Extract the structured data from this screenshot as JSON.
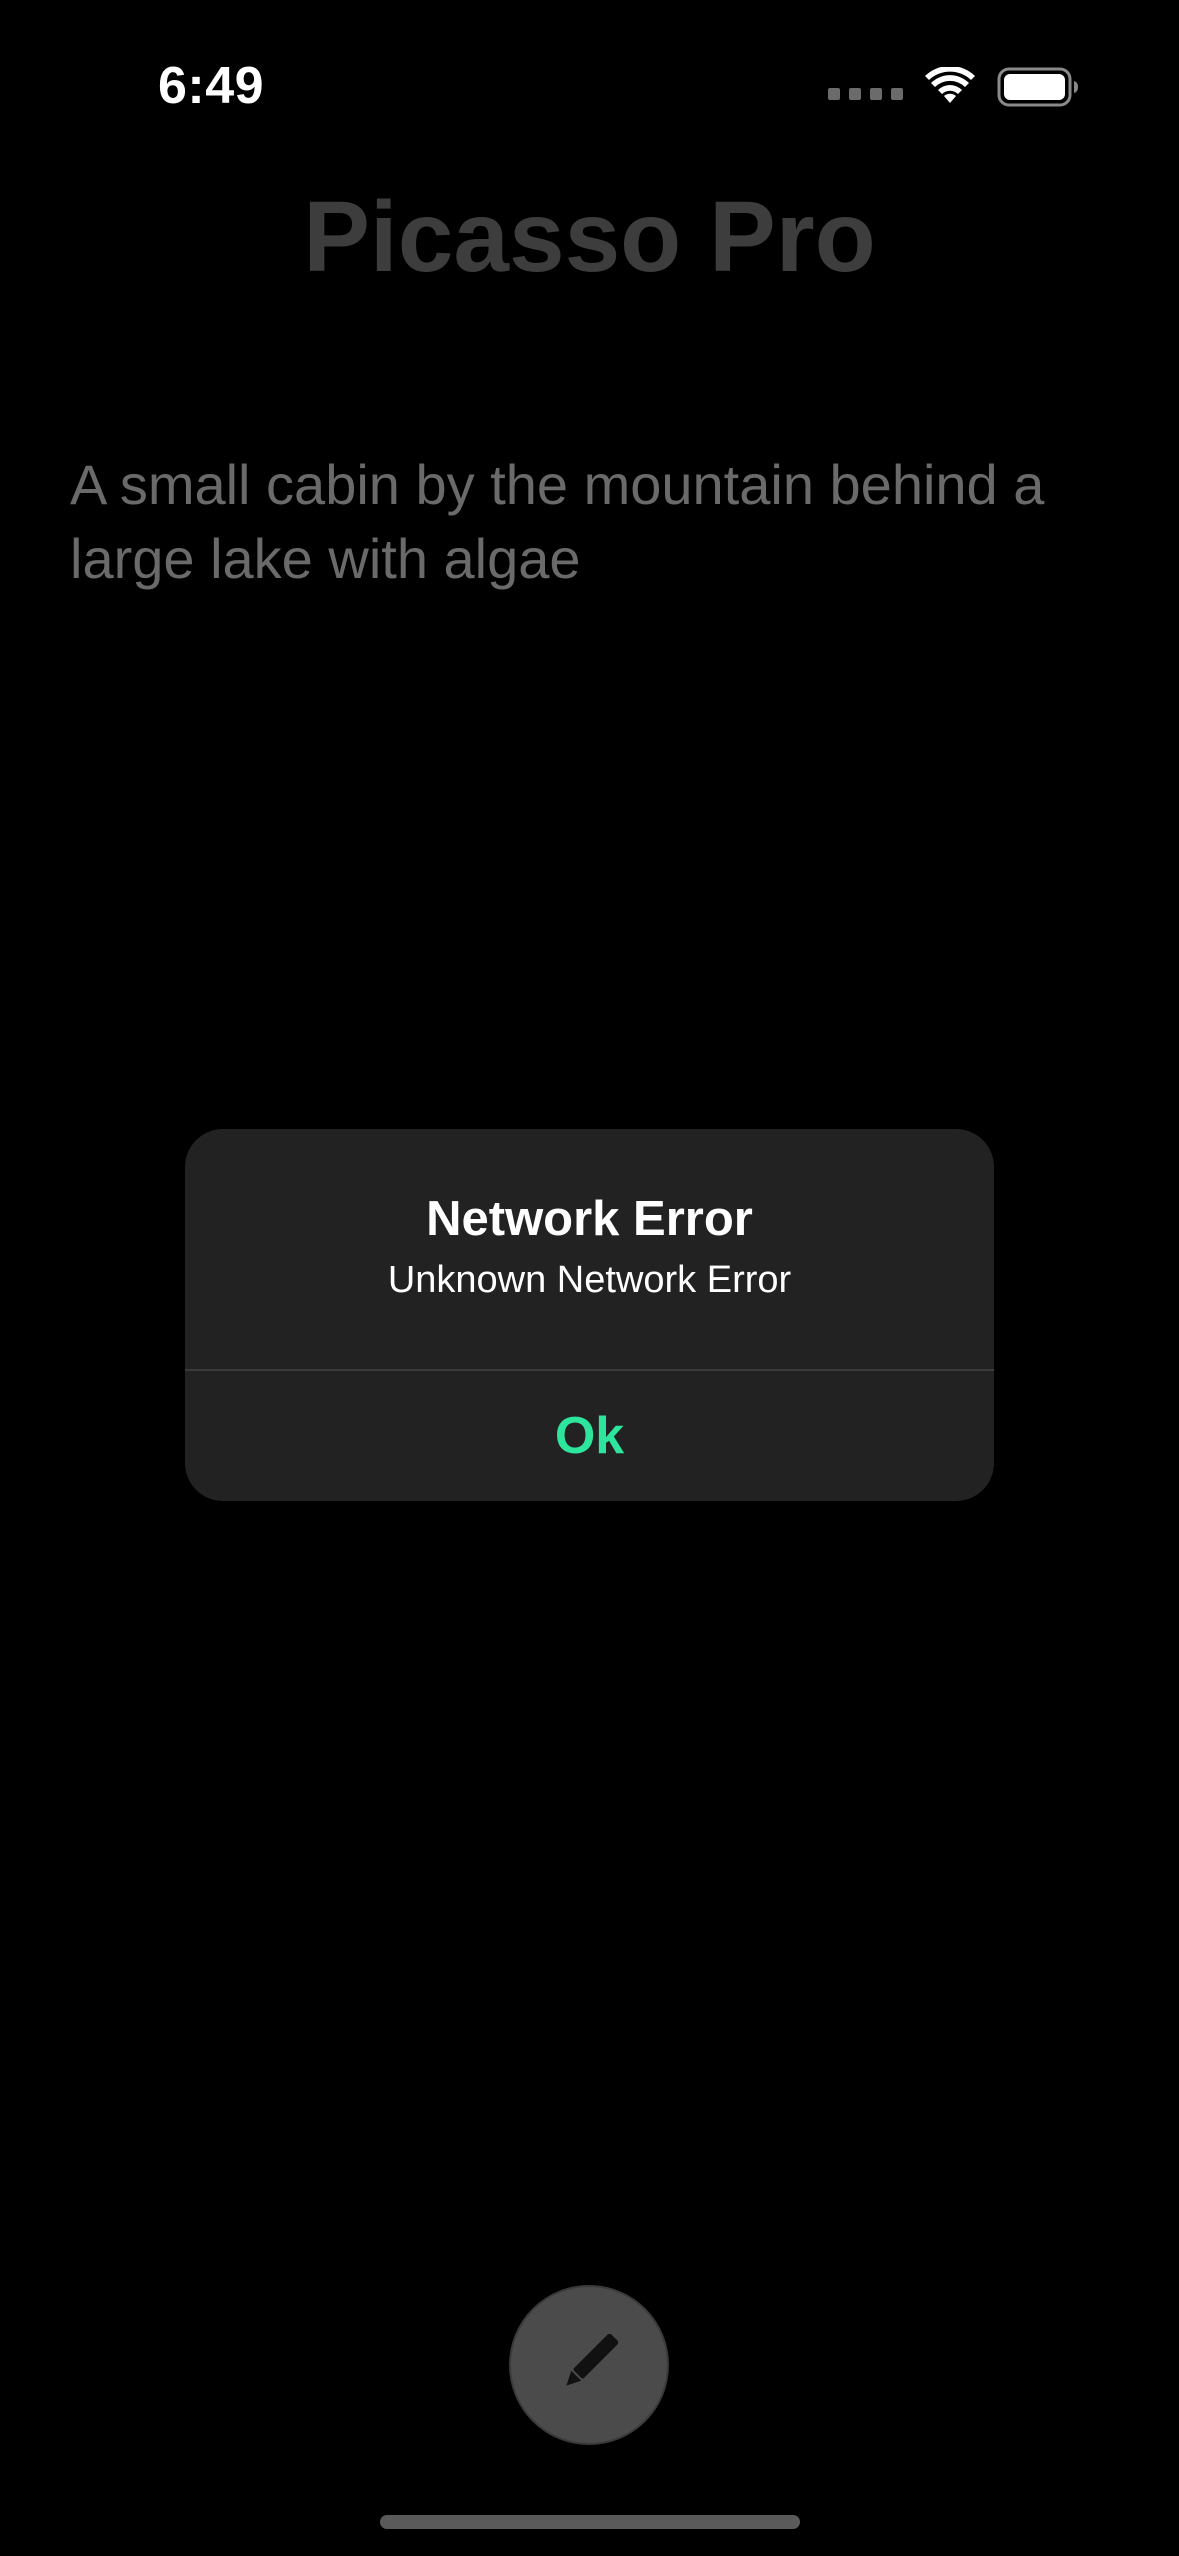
{
  "status_bar": {
    "time": "6:49",
    "icons": [
      "signal-dots-icon",
      "wifi-icon",
      "battery-icon"
    ]
  },
  "app": {
    "title": "Picasso Pro",
    "prompt": "A small cabin by the mountain behind a large lake with algae"
  },
  "alert": {
    "title": "Network Error",
    "message": "Unknown Network Error",
    "ok_label": "Ok",
    "accent_color": "#2ee59d"
  },
  "bottom": {
    "edit_icon": "pencil-icon"
  }
}
